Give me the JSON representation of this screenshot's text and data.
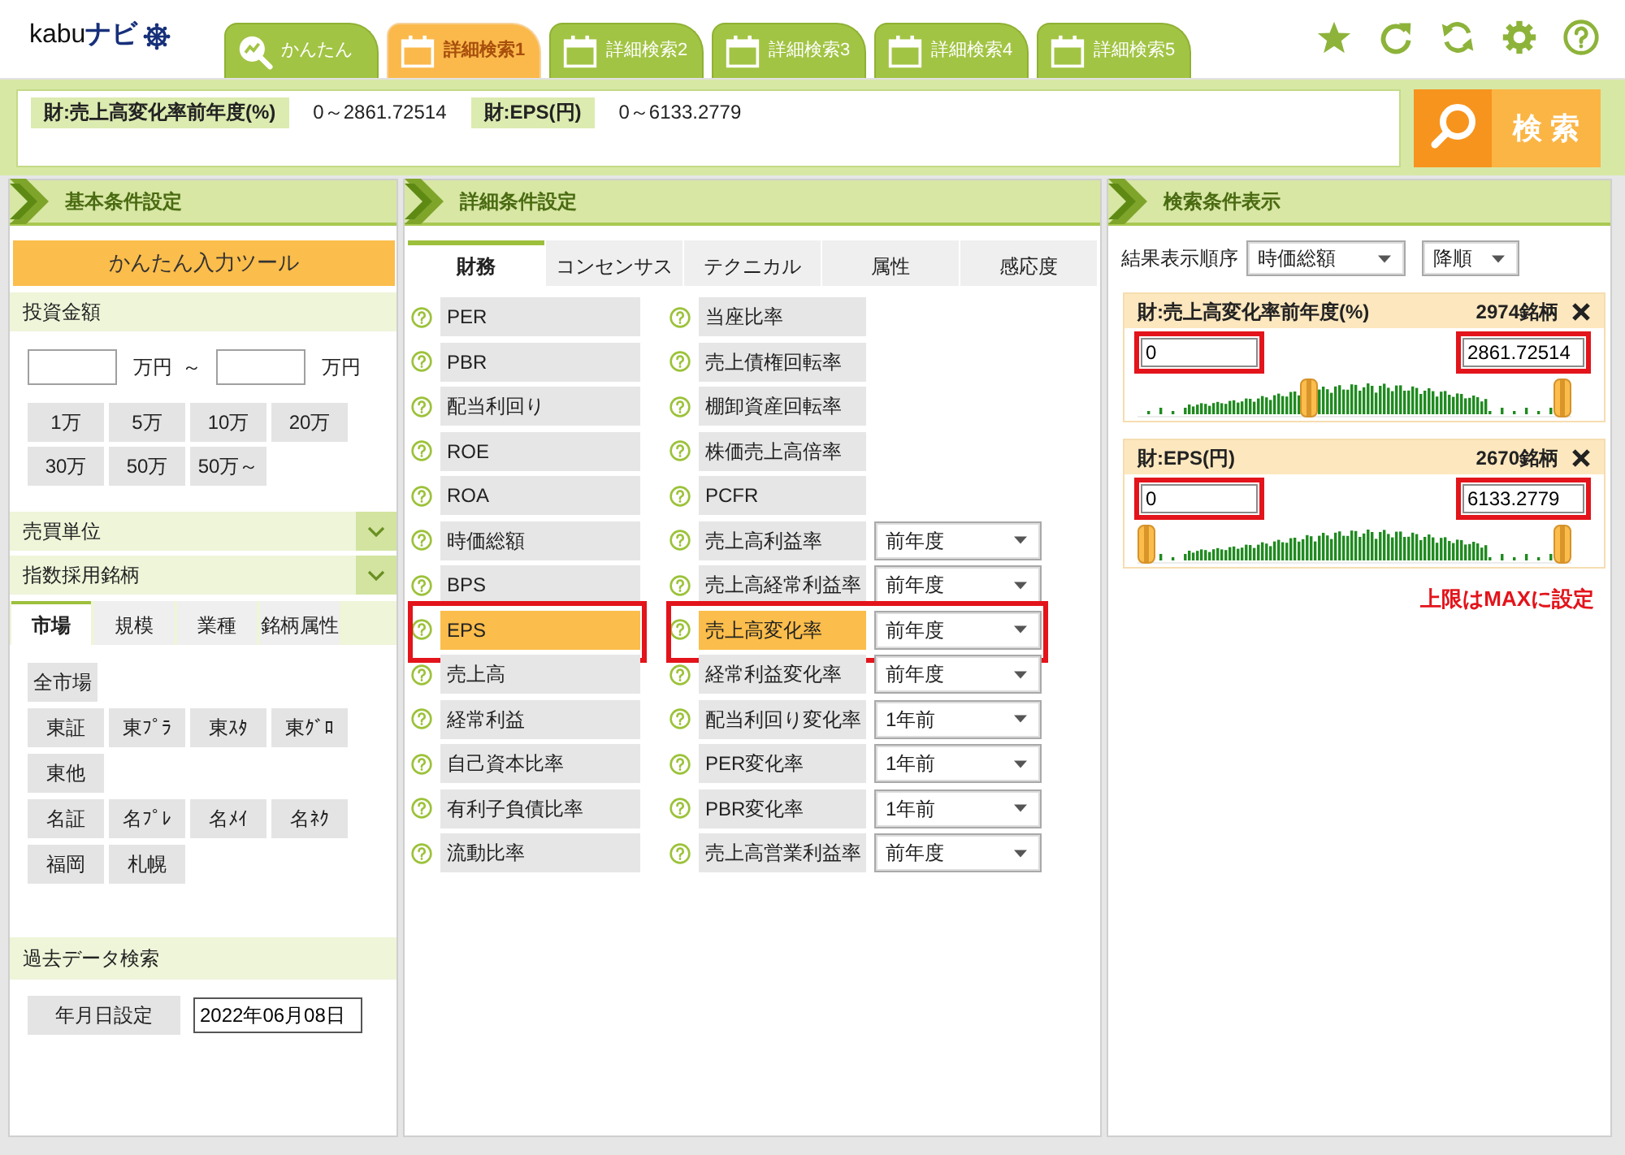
{
  "header": {
    "logo": "kabu**ナビ**",
    "tabs": [
      {
        "label": "かんたん",
        "kind": "simple",
        "selected": false
      },
      {
        "label": "詳細検索1",
        "kind": "detail",
        "selected": true
      },
      {
        "label": "詳細検索2",
        "kind": "detail",
        "selected": false
      },
      {
        "label": "詳細検索3",
        "kind": "detail",
        "selected": false
      },
      {
        "label": "詳細検索4",
        "kind": "detail",
        "selected": false
      },
      {
        "label": "詳細検索5",
        "kind": "detail",
        "selected": false
      }
    ]
  },
  "search_bar": {
    "conditions": [
      {
        "label": "財:売上高変化率前年度(%)",
        "range": "0～2861.72514"
      },
      {
        "label": "財:EPS(円)",
        "range": "0～6133.2779"
      }
    ],
    "button": "検 索"
  },
  "basic_panel": {
    "title": "基本条件設定",
    "tool_button": "かんたん入力ツール",
    "investment": {
      "title": "投資金額",
      "unit_from": "万円",
      "separator": "～",
      "unit_to": "万円",
      "amounts": [
        "1万",
        "5万",
        "10万",
        "20万",
        "30万",
        "50万",
        "50万～"
      ]
    },
    "dropdowns": [
      "売買単位",
      "指数採用銘柄"
    ],
    "market_tabs": [
      {
        "label": "市場",
        "selected": true
      },
      {
        "label": "規模",
        "selected": false
      },
      {
        "label": "業種",
        "selected": false
      },
      {
        "label": "銘柄属性",
        "selected": false
      }
    ],
    "market_rows": [
      [
        "全市場"
      ],
      [
        "東証",
        "東ﾌﾟﾗ",
        "東ｽﾀ",
        "東ｸﾞﾛ"
      ],
      [
        "東他"
      ],
      [
        "名証",
        "名ﾌﾟﾚ",
        "名ﾒｲ",
        "名ﾈｸ"
      ],
      [
        "福岡",
        "札幌"
      ]
    ],
    "past_data": {
      "title": "過去データ検索",
      "button": "年月日設定",
      "date": "2022年06月08日"
    }
  },
  "detail_panel": {
    "title": "詳細条件設定",
    "tabs": [
      {
        "label": "財務",
        "selected": true
      },
      {
        "label": "コンセンサス",
        "selected": false
      },
      {
        "label": "テクニカル",
        "selected": false
      },
      {
        "label": "属性",
        "selected": false
      },
      {
        "label": "感応度",
        "selected": false
      }
    ],
    "columns": [
      [
        {
          "label": "PER",
          "selected": false,
          "annotated": false
        },
        {
          "label": "PBR",
          "selected": false,
          "annotated": false
        },
        {
          "label": "配当利回り",
          "selected": false,
          "annotated": false
        },
        {
          "label": "ROE",
          "selected": false,
          "annotated": false
        },
        {
          "label": "ROA",
          "selected": false,
          "annotated": false
        },
        {
          "label": "時価総額",
          "selected": false,
          "annotated": false
        },
        {
          "label": "BPS",
          "selected": false,
          "annotated": false
        },
        {
          "label": "EPS",
          "selected": true,
          "annotated": true
        },
        {
          "label": "売上高",
          "selected": false,
          "annotated": false
        },
        {
          "label": "経常利益",
          "selected": false,
          "annotated": false
        },
        {
          "label": "自己資本比率",
          "selected": false,
          "annotated": false
        },
        {
          "label": "有利子負債比率",
          "selected": false,
          "annotated": false
        },
        {
          "label": "流動比率",
          "selected": false,
          "annotated": false
        }
      ],
      [
        {
          "label": "当座比率",
          "selected": false,
          "annotated": false
        },
        {
          "label": "売上債権回転率",
          "selected": false,
          "annotated": false
        },
        {
          "label": "棚卸資産回転率",
          "selected": false,
          "annotated": false
        },
        {
          "label": "株価売上高倍率",
          "selected": false,
          "annotated": false
        },
        {
          "label": "PCFR",
          "selected": false,
          "annotated": false
        },
        {
          "label": "売上高利益率",
          "period": "前年度",
          "selected": false,
          "annotated": false
        },
        {
          "label": "売上高経常利益率",
          "period": "前年度",
          "selected": false,
          "annotated": false
        },
        {
          "label": "売上高変化率",
          "period": "前年度",
          "selected": true,
          "annotated": true
        },
        {
          "label": "経常利益変化率",
          "period": "前年度",
          "selected": false,
          "annotated": false
        },
        {
          "label": "配当利回り変化率",
          "period": "1年前",
          "selected": false,
          "annotated": false
        },
        {
          "label": "PER変化率",
          "period": "1年前",
          "selected": false,
          "annotated": false
        },
        {
          "label": "PBR変化率",
          "period": "1年前",
          "selected": false,
          "annotated": false
        },
        {
          "label": "売上高営業利益率",
          "period": "前年度",
          "selected": false,
          "annotated": false
        }
      ]
    ]
  },
  "condition_panel": {
    "title": "検索条件表示",
    "sort_label": "結果表示順序",
    "sort_key": "時価総額",
    "sort_order": "降順",
    "cards": [
      {
        "title": "財:売上高変化率前年度(%)",
        "count": "2974銘柄",
        "min": {
          "value": "0",
          "annotated": true
        },
        "max": {
          "value": "2861.72514",
          "annotated": true
        },
        "handles": [
          {
            "level": 0.39
          },
          {
            "level": 1
          }
        ]
      },
      {
        "title": "財:EPS(円)",
        "count": "2670銘柄",
        "min": {
          "value": "0",
          "annotated": true
        },
        "max": {
          "value": "6133.2779",
          "annotated": true
        },
        "handles": [
          {
            "level": 0
          },
          {
            "level": 1
          }
        ]
      }
    ],
    "note": "上限はMAXに設定"
  }
}
